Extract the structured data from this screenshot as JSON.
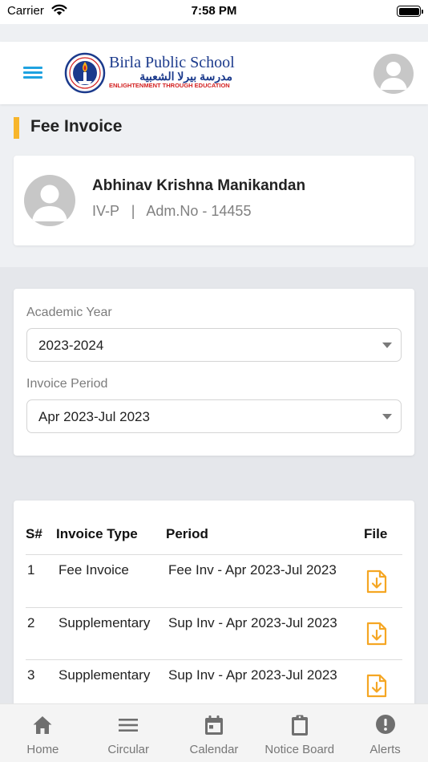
{
  "status_bar": {
    "carrier": "Carrier",
    "time": "7:58 PM"
  },
  "header": {
    "logo": {
      "name": "Birla Public School",
      "arabic": "مدرسة بيرلا الشعبية",
      "tagline": "ENLIGHTENMENT THROUGH EDUCATION"
    }
  },
  "page": {
    "title": "Fee Invoice"
  },
  "student": {
    "name": "Abhinav Krishna Manikandan",
    "meta": "IV-P   |   Adm.No - 14455"
  },
  "filters": {
    "academic_year": {
      "label": "Academic Year",
      "value": "2023-2024"
    },
    "invoice_period": {
      "label": "Invoice Period",
      "value": "Apr 2023-Jul 2023"
    }
  },
  "table": {
    "headers": {
      "sno": "S#",
      "type": "Invoice Type",
      "period": "Period",
      "file": "File"
    },
    "rows": [
      {
        "sno": "1",
        "type": "Fee Invoice",
        "period": "Fee Inv - Apr 2023-Jul 2023"
      },
      {
        "sno": "2",
        "type": "Supplementary",
        "period": "Sup Inv - Apr 2023-Jul 2023"
      },
      {
        "sno": "3",
        "type": "Supplementary",
        "period": "Sup Inv - Apr 2023-Jul 2023"
      }
    ]
  },
  "tabs": [
    {
      "label": "Home",
      "icon": "home-icon"
    },
    {
      "label": "Circular",
      "icon": "list-icon"
    },
    {
      "label": "Calendar",
      "icon": "calendar-icon"
    },
    {
      "label": "Notice Board",
      "icon": "clipboard-icon"
    },
    {
      "label": "Alerts",
      "icon": "alert-icon"
    }
  ],
  "colors": {
    "accent_blue": "#1fa2e0",
    "title_bar_yellow": "#f7b52b",
    "download_orange": "#f5a623",
    "logo_blue": "#1b3a8c",
    "logo_red": "#d21f1f"
  }
}
